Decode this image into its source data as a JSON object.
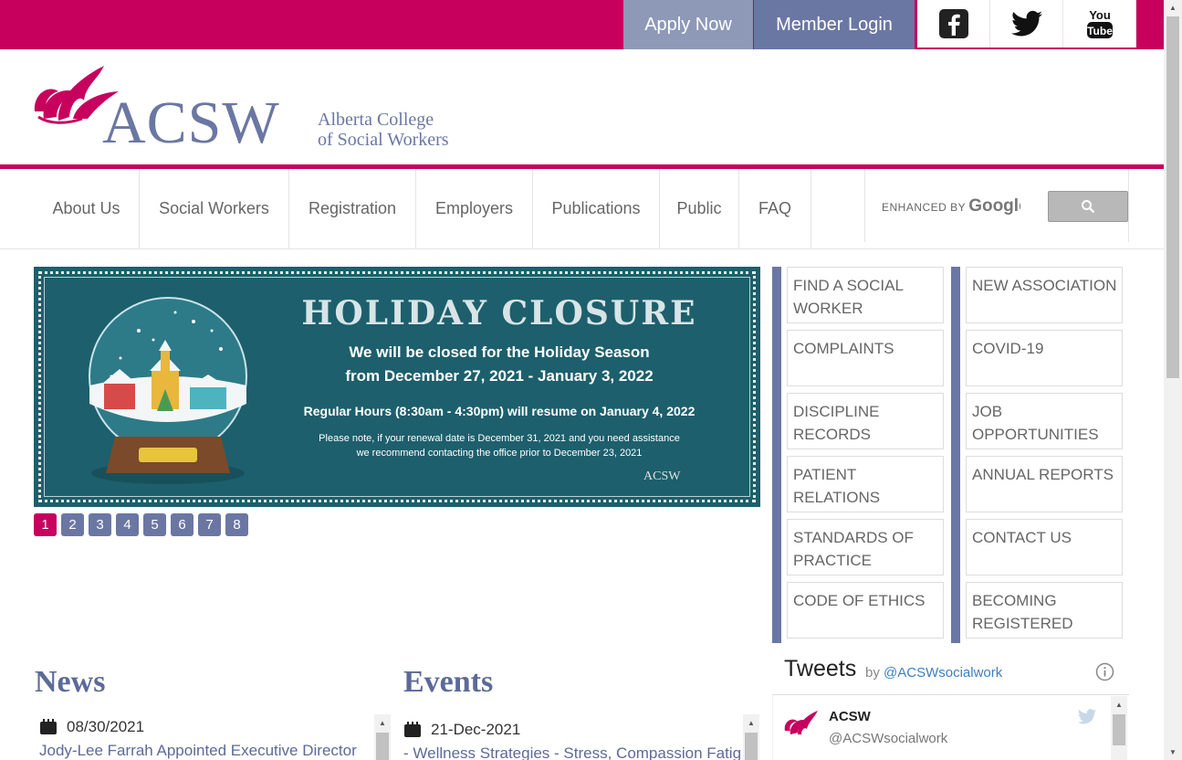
{
  "topbar": {
    "apply_label": "Apply Now",
    "login_label": "Member Login",
    "social": [
      "facebook-icon",
      "twitter-icon",
      "youtube-icon"
    ],
    "youtube_text_top": "You",
    "youtube_text_bottom": "Tube"
  },
  "logo": {
    "acsw": "ACSW",
    "line1": "Alberta College",
    "line2": "of Social Workers"
  },
  "nav": {
    "items": [
      "About Us",
      "Social Workers",
      "Registration",
      "Employers",
      "Publications",
      "Public",
      "FAQ"
    ]
  },
  "search": {
    "enhanced_by": "ENHANCED BY",
    "brand": "Google"
  },
  "banner": {
    "title": "HOLIDAY CLOSURE",
    "line1": "We will be closed for the Holiday Season",
    "line2": "from December 27, 2021 - January 3, 2022",
    "line3": "Regular Hours (8:30am - 4:30pm) will resume on January 4, 2022",
    "line4": "Please note, if your renewal date is December 31, 2021 and you need assistance",
    "line5": "we recommend contacting the office prior to December 23, 2021",
    "logo": "ACSW"
  },
  "pager": [
    "1",
    "2",
    "3",
    "4",
    "5",
    "6",
    "7",
    "8"
  ],
  "quick_links": {
    "left": [
      "FIND A SOCIAL WORKER",
      "COMPLAINTS",
      "DISCIPLINE RECORDS",
      "PATIENT RELATIONS",
      "STANDARDS OF PRACTICE",
      "CODE OF ETHICS"
    ],
    "right": [
      "NEW ASSOCIATION",
      "COVID-19",
      "JOB OPPORTUNITIES",
      "ANNUAL REPORTS",
      "CONTACT US",
      "BECOMING REGISTERED"
    ]
  },
  "news": {
    "heading": "News",
    "date": "08/30/2021",
    "link": "Jody-Lee Farrah Appointed Executive Director"
  },
  "events": {
    "heading": "Events",
    "date": "21-Dec-2021",
    "link": "- Wellness Strategies - Stress, Compassion Fatigue"
  },
  "tweets": {
    "heading": "Tweets",
    "by": "by",
    "handle_link": "@ACSWsocialwork",
    "account_name": "ACSW",
    "account_handle": "@ACSWsocialwork"
  },
  "colors": {
    "brand_magenta": "#c7005e",
    "brand_slate": "#6b77a3",
    "banner_teal": "#1d5f6c"
  }
}
